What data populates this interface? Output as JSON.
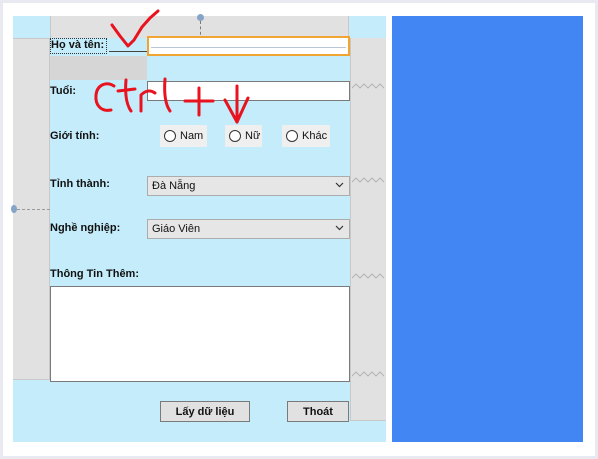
{
  "form": {
    "fields": {
      "ho_ten_label": "Họ và tên:",
      "ho_ten_value": "",
      "tuoi_label": "Tuổi:",
      "tuoi_value": "",
      "gioi_tinh_label": "Giới tính:",
      "tinh_thanh_label": "Tỉnh thành:",
      "tinh_thanh_value": "Đà Nẵng",
      "nghe_nghiep_label": "Nghề nghiệp:",
      "nghe_nghiep_value": "Giáo Viên",
      "thong_tin_label": "Thông Tin Thêm:",
      "thong_tin_value": ""
    },
    "gender_options": [
      {
        "label": "Nam",
        "selected": false
      },
      {
        "label": "Nữ",
        "selected": false
      },
      {
        "label": "Khác",
        "selected": false
      }
    ],
    "buttons": {
      "lay_du_lieu": "Lấy dữ liệu",
      "thoat": "Thoát"
    }
  },
  "annotation": {
    "checkmark_icon": "check-mark-handwritten",
    "shortcut_text": "Ctrl + ↓",
    "color": "#e8131f"
  },
  "colors": {
    "form_background": "#c4ecfa",
    "right_panel": "#4286f4",
    "focused_border": "#f0a431"
  }
}
